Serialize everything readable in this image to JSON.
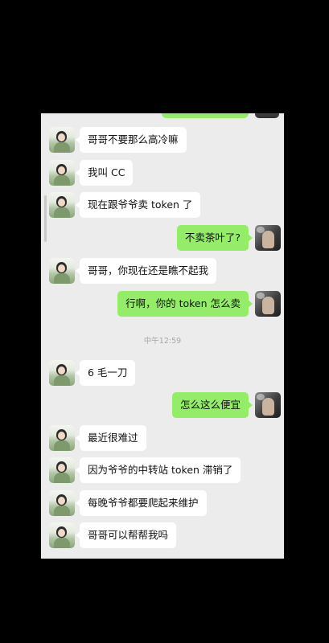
{
  "chat": {
    "timestamp": "中午12:59",
    "messages": [
      {
        "side": "left",
        "text": "哥哥不要那么高冷嘛"
      },
      {
        "side": "left",
        "text": "我叫 CC"
      },
      {
        "side": "left",
        "text": "现在跟爷爷卖 token 了"
      },
      {
        "side": "right",
        "text": "不卖茶叶了?"
      },
      {
        "side": "left",
        "text": "哥哥，你现在还是瞧不起我"
      },
      {
        "side": "right",
        "text": "行啊，你的 token 怎么卖"
      },
      {
        "side": "left",
        "text": "6 毛一刀"
      },
      {
        "side": "right",
        "text": "怎么这么便宜"
      },
      {
        "side": "left",
        "text": "最近很难过"
      },
      {
        "side": "left",
        "text": "因为爷爷的中转站 token 滞销了"
      },
      {
        "side": "left",
        "text": "每晚爷爷都要爬起来维护"
      },
      {
        "side": "left",
        "text": "哥哥可以帮帮我吗"
      }
    ]
  },
  "colors": {
    "background": "#000000",
    "chat_background": "#ececec",
    "incoming_bubble": "#ffffff",
    "outgoing_bubble": "#95ec69",
    "timestamp_text": "#a8a8a8"
  },
  "icons": {
    "contact_avatar": "female-contact-avatar-icon",
    "self_avatar": "self-avatar-icon"
  }
}
